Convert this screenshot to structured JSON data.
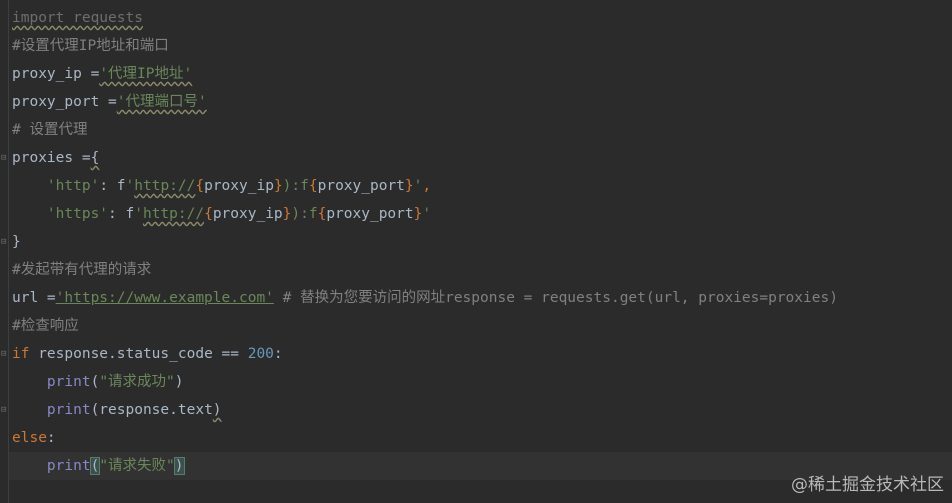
{
  "lines": {
    "l1": "import requests",
    "l2": "#设置代理IP地址和端口",
    "l3_var": "proxy_ip =",
    "l3_str": "'代理IP地址'",
    "l4_var": "proxy_port =",
    "l4_str": "'代理端口号'",
    "l5": "# 设置代理",
    "l6_var": "proxies =",
    "l6_brace": "{",
    "l7_key": "'http'",
    "l7_colon": ": f",
    "l7_s1": "'",
    "l7_url": "http://",
    "l7_o1": "{",
    "l7_v1": "proxy_ip",
    "l7_c1": "}",
    "l7_mid": "):f",
    "l7_o2": "{",
    "l7_v2": "proxy_port",
    "l7_c2": "}",
    "l7_end": "'",
    "l7_comma": ",",
    "l8_key": "'https'",
    "l8_colon": ": f",
    "l8_s1": "'",
    "l8_url": "http://",
    "l8_o1": "{",
    "l8_v1": "proxy_ip",
    "l8_c1": "}",
    "l8_mid": "):f",
    "l8_o2": "{",
    "l8_v2": "proxy_port",
    "l8_c2": "}",
    "l8_end": "'",
    "l9": "}",
    "l10": "#发起带有代理的请求",
    "l11_var": "url =",
    "l11_str": "'https://www.example.com'",
    "l11_cmt": " # 替换为您要访问的网址response = requests.get(url, proxies=proxies)",
    "l12": "#检查响应",
    "l13_kw": "if",
    "l13_mid": " response.status_code == ",
    "l13_num": "200",
    "l13_end": ":",
    "l14_fn": "print",
    "l14_open": "(",
    "l14_str": "\"请求成功\"",
    "l14_close": ")",
    "l15_fn": "print",
    "l15_rest": "(response.text",
    "l15_close": ")",
    "l16_kw": "else",
    "l16_colon": ":",
    "l17_fn": "print",
    "l17_open": "(",
    "l17_str": "\"请求失败\"",
    "l17_close": ")"
  },
  "watermark": "@稀土掘金技术社区",
  "colors": {
    "background": "#2b2b2b",
    "keyword": "#cc7832",
    "string": "#6a8759",
    "comment": "#808080",
    "number": "#6897bb",
    "builtin": "#8888c6",
    "text": "#a9b7c6"
  }
}
